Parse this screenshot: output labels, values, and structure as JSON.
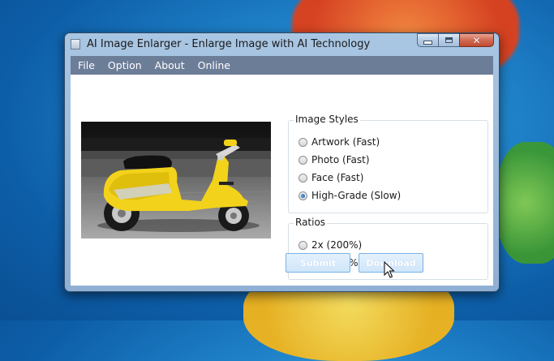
{
  "window": {
    "title": "AI Image Enlarger - Enlarge Image with AI Technology"
  },
  "menu": [
    "File",
    "Option",
    "About",
    "Online"
  ],
  "image_styles": {
    "title": "Image Styles",
    "options": [
      {
        "label": "Artwork (Fast)",
        "checked": false
      },
      {
        "label": "Photo (Fast)",
        "checked": false
      },
      {
        "label": "Face (Fast)",
        "checked": false
      },
      {
        "label": "High-Grade (Slow)",
        "checked": true
      }
    ]
  },
  "ratios": {
    "title": "Ratios",
    "options": [
      {
        "label": "2x (200%)",
        "checked": false
      },
      {
        "label": "4x (400%)",
        "checked": true
      }
    ]
  },
  "buttons": {
    "submit": "Submit",
    "download": "Download"
  },
  "colors": {
    "menubar": "#6c7d98",
    "scooter": "#f2d21a",
    "button_border": "#7bb2e6"
  }
}
